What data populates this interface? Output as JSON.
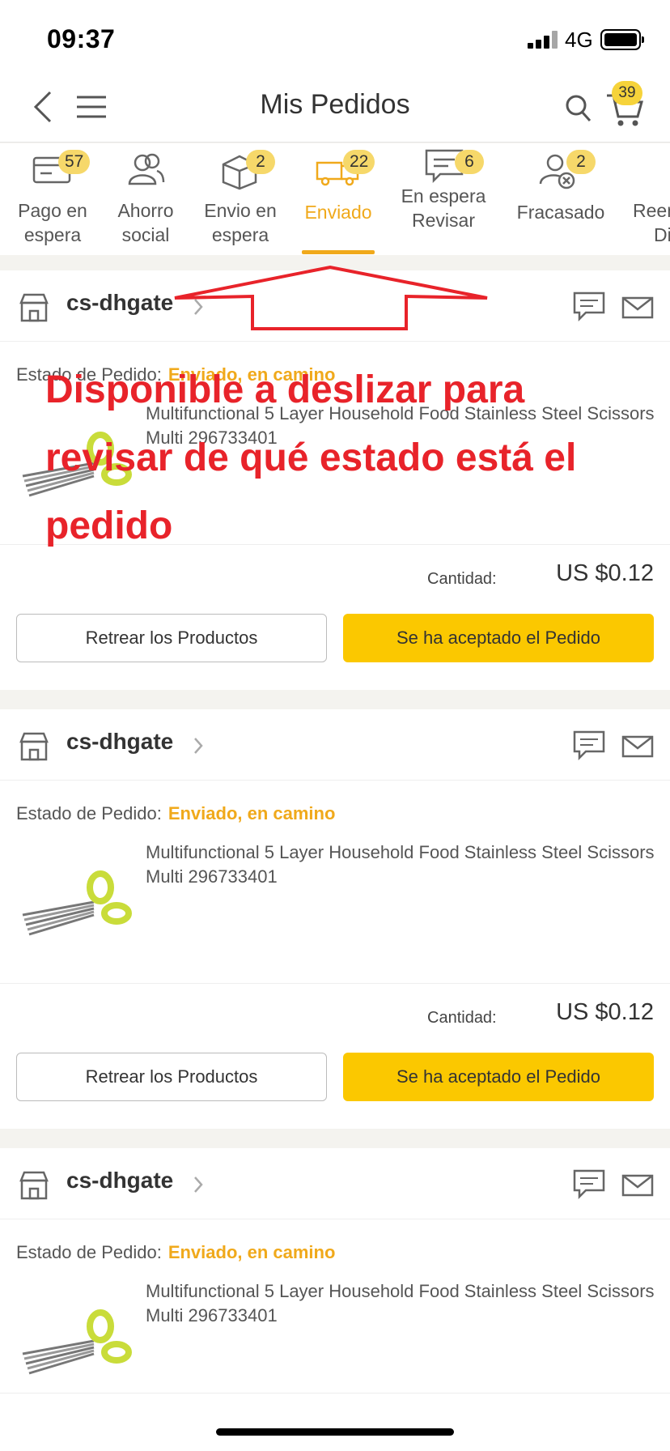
{
  "status_bar": {
    "time": "09:37",
    "network": "4G"
  },
  "nav": {
    "title": "Mis Pedidos",
    "cart_count": "39"
  },
  "tabs": [
    {
      "label1": "Pago en",
      "label2": "espera",
      "badge": "57",
      "icon": "invoice-icon"
    },
    {
      "label1": "Ahorro",
      "label2": "social",
      "badge": "",
      "icon": "group-users-icon"
    },
    {
      "label1": "Envio en",
      "label2": "espera",
      "badge": "2",
      "icon": "box-icon"
    },
    {
      "label1": "Enviado",
      "label2": "",
      "badge": "22",
      "icon": "truck-icon",
      "active": true
    },
    {
      "label1": "En espera",
      "label2": "Revisar",
      "badge": "6",
      "icon": "review-icon"
    },
    {
      "label1": "Fracasado",
      "label2": "",
      "badge": "2",
      "icon": "failed-user-icon"
    },
    {
      "label1": "Reen",
      "label2": "Di",
      "badge": "",
      "icon": ""
    }
  ],
  "orders": [
    {
      "store": "cs-dhgate",
      "status_label": "Estado de Pedido:",
      "status_value": "Enviado, en camino",
      "product_title": "Multifunctional 5 Layer Household Food Stainless Steel Scissors Multi 296733401",
      "qty_label": "Cantidad:",
      "price": "US $0.12",
      "btn_secondary": "Retrear los Productos",
      "btn_primary": "Se ha aceptado el Pedido"
    },
    {
      "store": "cs-dhgate",
      "status_label": "Estado de Pedido:",
      "status_value": "Enviado, en camino",
      "product_title": "Multifunctional 5 Layer Household Food Stainless Steel Scissors Multi 296733401",
      "qty_label": "Cantidad:",
      "price": "US $0.12",
      "btn_secondary": "Retrear los Productos",
      "btn_primary": "Se ha aceptado el Pedido"
    },
    {
      "store": "cs-dhgate",
      "status_label": "Estado de Pedido:",
      "status_value": "Enviado, en camino",
      "product_title": "Multifunctional 5 Layer Household Food Stainless Steel Scissors Multi 296733401"
    }
  ],
  "annotation": {
    "line1": "Disponible a deslizar para",
    "line2": "revisar de qué estado está el",
    "line3": "pedido"
  },
  "colors": {
    "accent": "#f0a91b",
    "button_primary": "#fbc800",
    "badge": "#f6d86a",
    "annotation": "#e8232a"
  }
}
